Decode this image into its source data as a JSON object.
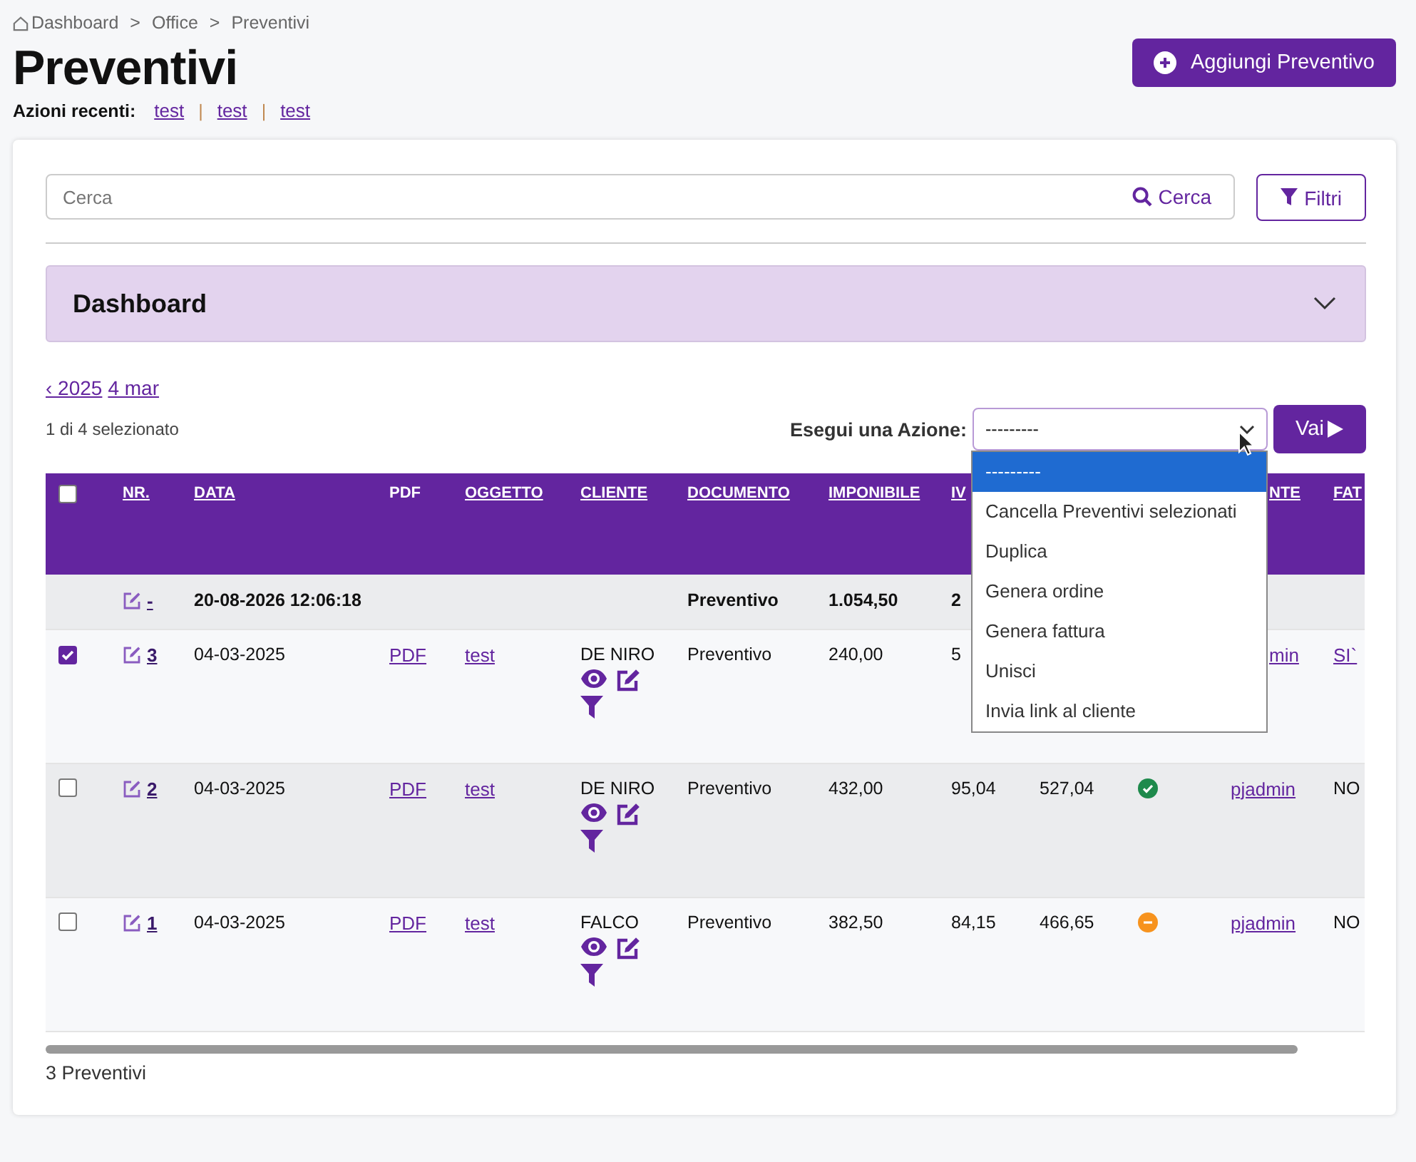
{
  "breadcrumb": {
    "items": [
      "Dashboard",
      "Office",
      "Preventivi"
    ],
    "separator": ">"
  },
  "title": "Preventivi",
  "recent": {
    "label": "Azioni recenti:",
    "links": [
      "test",
      "test",
      "test"
    ],
    "separator": "|"
  },
  "add_button": "Aggiungi Preventivo",
  "search": {
    "placeholder": "Cerca",
    "button": "Cerca",
    "filter_button": "Filtri"
  },
  "dashboard_panel": {
    "title": "Dashboard",
    "expanded": false
  },
  "date_nav": {
    "prev": "‹ 2025",
    "current": "4 mar"
  },
  "selection_count": "1 di 4 selezionato",
  "action": {
    "label": "Esegui una Azione:",
    "value": "---------",
    "button": "Vai",
    "options": [
      {
        "label": "---------",
        "selected": true
      },
      {
        "label": "Cancella Preventivi selezionati",
        "selected": false
      },
      {
        "label": "Duplica",
        "selected": false
      },
      {
        "label": "Genera ordine",
        "selected": false
      },
      {
        "label": "Genera fattura",
        "selected": false
      },
      {
        "label": "Unisci",
        "selected": false
      },
      {
        "label": "Invia link al cliente",
        "selected": false
      }
    ]
  },
  "table": {
    "select_all_checked": false,
    "columns": [
      {
        "label": "NR.",
        "sortable": true
      },
      {
        "label": "DATA",
        "sortable": true
      },
      {
        "label": "PDF",
        "sortable": false
      },
      {
        "label": "OGGETTO",
        "sortable": true
      },
      {
        "label": "CLIENTE",
        "sortable": true
      },
      {
        "label": "DOCUMENTO",
        "sortable": true
      },
      {
        "label": "IMPONIBILE",
        "sortable": true
      },
      {
        "label": "IV",
        "sortable": true
      },
      {
        "label": "NTE",
        "sortable": true,
        "partly_covered": true
      },
      {
        "label": "FAT",
        "sortable": true
      }
    ],
    "total_row": {
      "nr": "-",
      "data": "20-08-2026 12:06:18",
      "documento": "Preventivo",
      "imponibile": "1.054,50",
      "iva": "2"
    },
    "rows": [
      {
        "checked": true,
        "nr": "3",
        "data": "04-03-2025",
        "pdf": "PDF",
        "oggetto": "test",
        "cliente": "DE NIRO",
        "documento": "Preventivo",
        "imponibile": "240,00",
        "iva": "5",
        "utente": "min",
        "utente_partly_covered": true,
        "fatturato": "SI`",
        "fatturato_link": true
      },
      {
        "checked": false,
        "nr": "2",
        "data": "04-03-2025",
        "pdf": "PDF",
        "oggetto": "test",
        "cliente": "DE NIRO",
        "documento": "Preventivo",
        "imponibile": "432,00",
        "iva": "95,04",
        "totale": "527,04",
        "status": {
          "kind": "ok",
          "color": "#1e8a4c"
        },
        "utente": "pjadmin",
        "fatturato": "NO",
        "fatturato_link": false
      },
      {
        "checked": false,
        "nr": "1",
        "data": "04-03-2025",
        "pdf": "PDF",
        "oggetto": "test",
        "cliente": "FALCO",
        "documento": "Preventivo",
        "imponibile": "382,50",
        "iva": "84,15",
        "totale": "466,65",
        "status": {
          "kind": "pending",
          "color": "#f7931e"
        },
        "utente": "pjadmin",
        "fatturato": "NO",
        "fatturato_link": false
      }
    ]
  },
  "footer": "3 Preventivi"
}
